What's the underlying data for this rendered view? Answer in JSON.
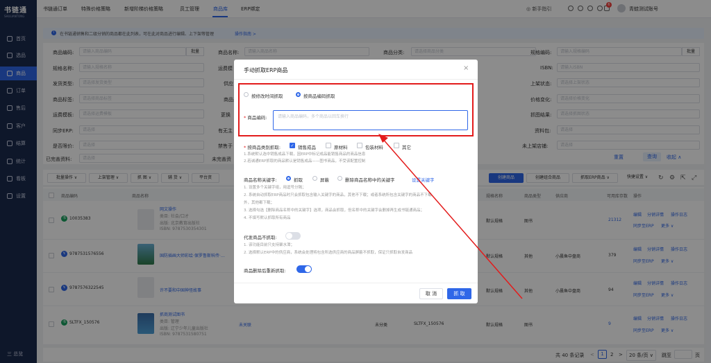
{
  "sidebar": {
    "logo": "书链通",
    "logo_sub": "SHULIANTONG",
    "items": [
      {
        "label": "首页"
      },
      {
        "label": "选品"
      },
      {
        "label": "商品"
      },
      {
        "label": "订单"
      },
      {
        "label": "售后"
      },
      {
        "label": "客户"
      },
      {
        "label": "结算"
      },
      {
        "label": "统计"
      },
      {
        "label": "看板"
      },
      {
        "label": "设置"
      }
    ],
    "collapse_label": "三 总览"
  },
  "topbar": {
    "tabs": [
      {
        "label": "书链通订单"
      },
      {
        "label": "特殊价格策略"
      },
      {
        "label": "新增阶梯价格策略"
      },
      {
        "label": "员工管理"
      },
      {
        "label": "商品库"
      },
      {
        "label": "ERP绑定"
      }
    ],
    "active_tab": "商品库",
    "guide": "新手指引",
    "badge": "6",
    "user": "青蛙测试账号"
  },
  "infobar": {
    "text": "在书链通销售和二级分销的商品都在此列表，可在此对商品进行编辑、上下架等管理",
    "link": "操作指南 >"
  },
  "filters": {
    "labels": [
      "商品编码:",
      "规格名称:",
      "发货类型:",
      "商品标签:",
      "运费模板:",
      "同步ERP:",
      "是否限价:",
      "已完善资料:",
      "商品名称:",
      "运费模",
      "供应",
      "商品类",
      "更换",
      "有无主",
      "禁售于",
      "未完善资",
      "商品分类:",
      "规格编码:",
      "ISBN:",
      "上架状态:",
      "价格变化:",
      "抓图结果:",
      "资料包:",
      "未上架店铺:"
    ],
    "placeholders": {
      "code": "请输入商品编码",
      "name": "请输入商品名称",
      "category": "请选择商品分类",
      "spec_code": "请输入规格编码",
      "spec_name": "请输入规格名称",
      "isbn": "请输入ISBN",
      "ship": "请选择发货类型",
      "tag": "请选择商品标签",
      "freight": "请选择运费模板",
      "select": "请选择",
      "shelf": "请选择上架状态",
      "price": "请选择价格变化",
      "grab": "请选择抓图状态"
    },
    "batch": "批量",
    "reset": "重置",
    "search": "查询",
    "fold": "收起 ∧"
  },
  "toolbar": {
    "left": [
      "批量操作 ∨",
      "上架管理 ∨",
      "抓 图 ∨",
      "辅 货 ∨",
      "平台资"
    ],
    "right": [
      "创建商品",
      "创建组合商品",
      "抓取ERP商品 ∨",
      "快捷设置 ∨"
    ]
  },
  "table": {
    "headers": [
      "商品编码",
      "商品名称",
      "规格名称",
      "商品类型",
      "供应商",
      "可用库存数",
      "操作"
    ],
    "rows": [
      {
        "code": "10035383",
        "title": "网文操作",
        "l2": "类目: 社会/口才",
        "l3": "出版: 北京教育出版社",
        "l4": "ISBN: 9787530354301",
        "spec": "默认规格",
        "type": "图书",
        "supplier": "",
        "stock": "21312",
        "ops": [
          "编辑",
          "分销详情",
          "操作日志",
          "同步至ERP",
          "更多 ∨"
        ]
      },
      {
        "code": "9787531576556",
        "title": "国防插画大师彩绘·保罗鲁斯科传·…",
        "l2": "",
        "l3": "",
        "l4": "",
        "spec": "默认规格",
        "type": "其他",
        "supplier": "小晨鱼中盘商",
        "stock": "379",
        "ops": [
          "编辑",
          "分销详情",
          "操作日志",
          "同步至ERP",
          "更多 ∨"
        ]
      },
      {
        "code": "9787576322545",
        "title": "许不要和中国神怪故事",
        "l2": "",
        "l3": "",
        "l4": "",
        "spec": "默认规格",
        "type": "其他",
        "supplier": "小晨鱼中盘商",
        "stock": "94",
        "ops": [
          "编辑",
          "分销详情",
          "操作日志",
          "同步至ERP",
          "更多 ∨"
        ]
      },
      {
        "code": "SLTFX_150576",
        "title": "抓商测试图书",
        "l2": "类目: 管理",
        "l3": "出版: 辽宁少年儿童出版社",
        "l4": "ISBN: 9787531580751",
        "spec": "默认规格",
        "type": "图书",
        "supplier": "",
        "stock": "9",
        "ops": [
          "编辑",
          "分销详情",
          "操作日志",
          "同步至ERP",
          "更多 ∨"
        ],
        "extra1": "未关联",
        "extra2": "未分类",
        "extra3": "SLTFX_150576"
      }
    ]
  },
  "pagination": {
    "total": "共 40 条记录",
    "prev": "<",
    "pages": [
      "1",
      "2"
    ],
    "next": ">",
    "per_page": "20 条/页 ∨",
    "jump": "跳至",
    "jump_suffix": "页"
  },
  "modal": {
    "title": "手动抓取ERP商品",
    "close": "×",
    "opt_time": "按修改时间抓取",
    "opt_code": "按商品编码抓取",
    "code_label": "商品编码:",
    "code_placeholder": "请输入商品编码，多个商品以回车换行",
    "cat_label": "按商品类别抓取:",
    "cats": [
      "销售成品",
      "原材料",
      "包装材料",
      "其它"
    ],
    "cat_hint1": "1.系统默认选中销售成品下载，因ERP中标记成品能销售商品的商品信息",
    "cat_hint2": "2.若诚通ERP抓取的商品默认是销售成品——图书商品，不受该配置控制",
    "kw_label": "商品名称关键字:",
    "kw_opts": [
      "抓取",
      "屏蔽",
      "删除商品名称中的关键字"
    ],
    "kw_link": "设置关键字",
    "kw_hints": [
      "1. 设置多个关键字组，用逗号分隔；",
      "2. 系统自动抓取ERP商品时只会抓取包含输入关键字的商品，其他不下载；或者系统所包含关键字的商品不下载",
      "外，其他都下载；",
      "3. 选择勾选【删除商品名称中的关键字】选项，商品会抓取，但名称中的关键字会删掉再生成书链通商品；",
      "4. 不填写默认抓取所有商品"
    ],
    "proxy_label": "代发商品不抓取:",
    "proxy_hints": [
      "1. 该功能目前只支持聚水潭；",
      "2. 选择默认ERP中的供应商，系统会处理将包含所选供应商的商品屏蔽不抓取，保证只抓取自发商品"
    ],
    "refetch_label": "商品删除后重新抓取:",
    "cancel": "取 消",
    "confirm": "抓 取"
  }
}
